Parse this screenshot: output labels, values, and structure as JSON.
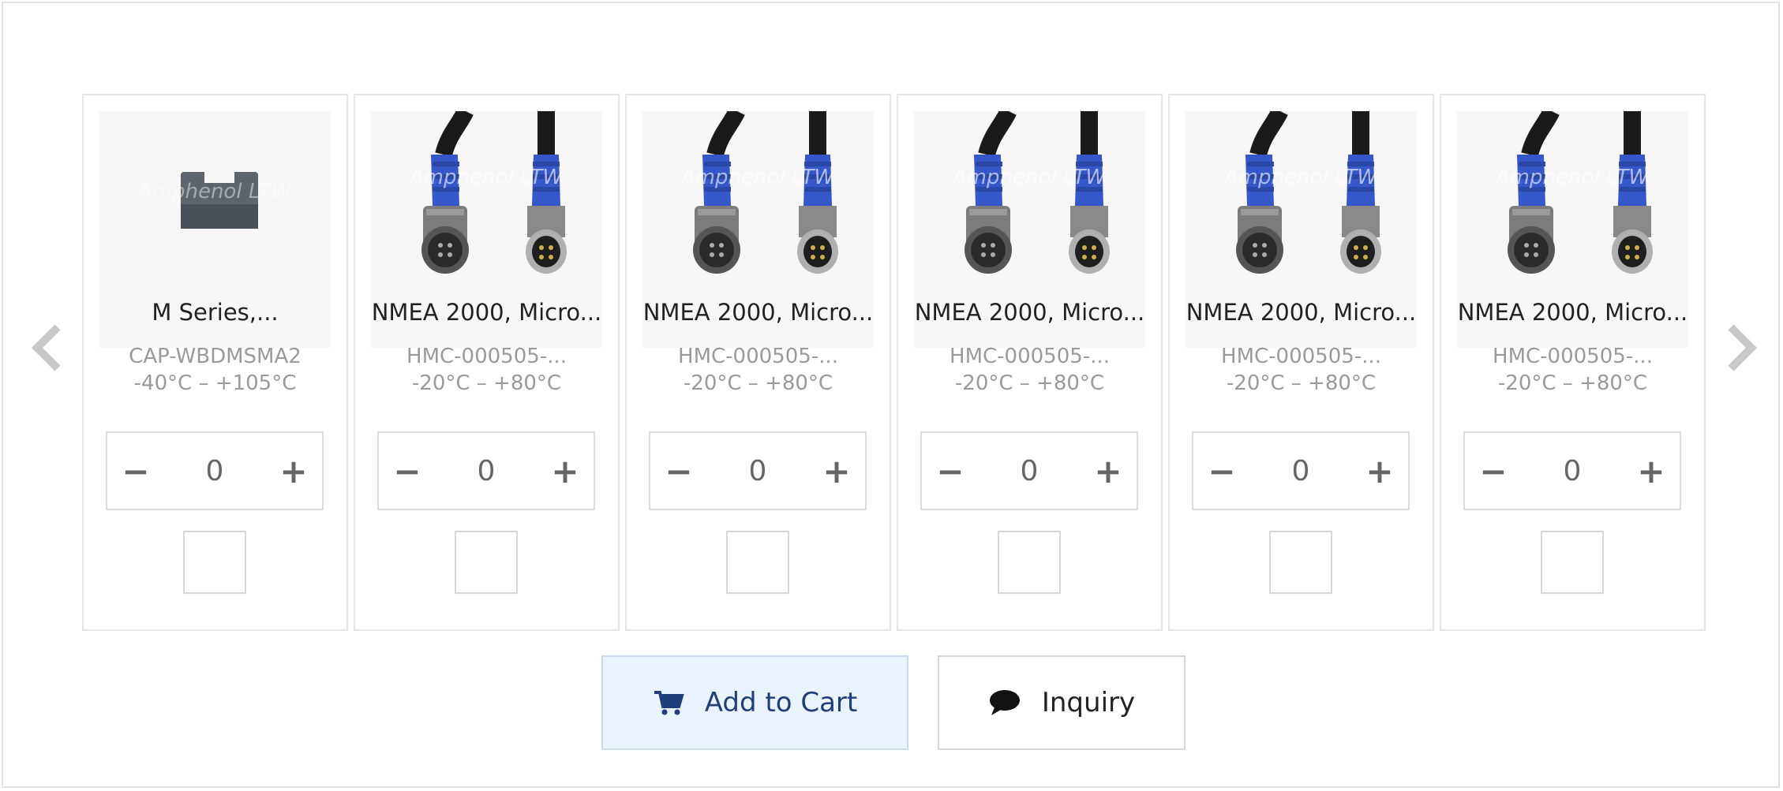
{
  "carousel": {
    "prev_icon": "chevron-left-icon",
    "next_icon": "chevron-right-icon",
    "arrow_color": "#c8c8c8"
  },
  "products": [
    {
      "title": "M Series,...",
      "part_number": "CAP-WBDMSMA2",
      "temperature": "-40°C – +105°C",
      "quantity": "0",
      "image": "connector-cap-image",
      "watermark": "Amphenol LTW"
    },
    {
      "title": "NMEA 2000, Micro...",
      "part_number": "HMC-000505-...",
      "temperature": "-20°C – +80°C",
      "quantity": "0",
      "image": "cable-connector-image",
      "watermark": "Amphenol LTW"
    },
    {
      "title": "NMEA 2000, Micro...",
      "part_number": "HMC-000505-...",
      "temperature": "-20°C – +80°C",
      "quantity": "0",
      "image": "cable-connector-image",
      "watermark": "Amphenol LTW"
    },
    {
      "title": "NMEA 2000, Micro...",
      "part_number": "HMC-000505-...",
      "temperature": "-20°C – +80°C",
      "quantity": "0",
      "image": "cable-connector-image",
      "watermark": "Amphenol LTW"
    },
    {
      "title": "NMEA 2000, Micro...",
      "part_number": "HMC-000505-...",
      "temperature": "-20°C – +80°C",
      "quantity": "0",
      "image": "cable-connector-image",
      "watermark": "Amphenol LTW"
    },
    {
      "title": "NMEA 2000, Micro...",
      "part_number": "HMC-000505-...",
      "temperature": "-20°C – +80°C",
      "quantity": "0",
      "image": "cable-connector-image",
      "watermark": "Amphenol LTW"
    }
  ],
  "stepper": {
    "minus": "−",
    "plus": "+"
  },
  "actions": {
    "add_to_cart": "Add to Cart",
    "inquiry": "Inquiry",
    "cart_icon": "cart-icon",
    "inquiry_icon": "chat-bubble-icon"
  },
  "colors": {
    "cable_blue": "#3557c9",
    "cart_button_bg": "#eaf2fc",
    "cart_text": "#1f3f7a"
  }
}
